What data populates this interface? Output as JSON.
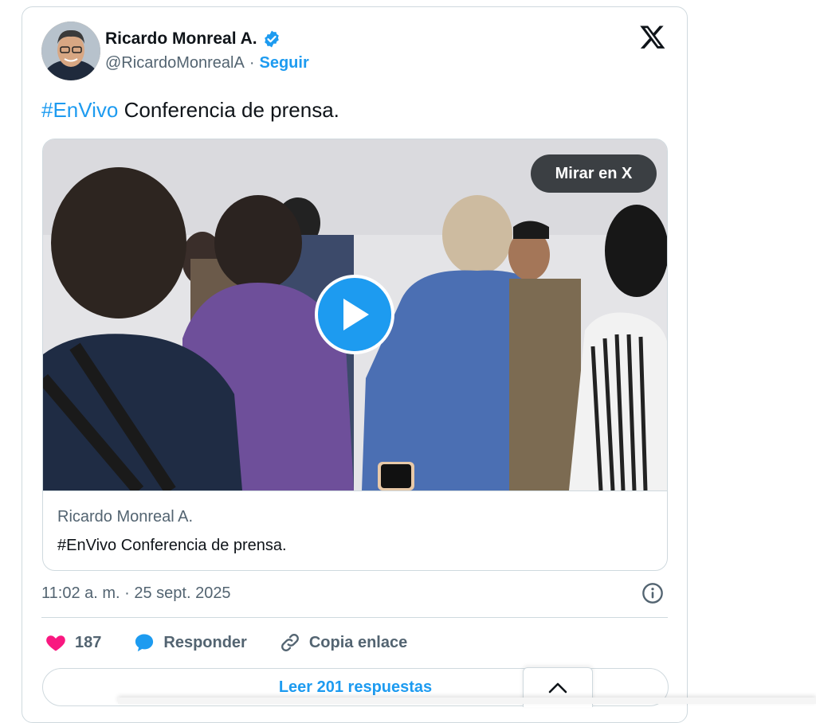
{
  "author": {
    "name": "Ricardo Monreal A.",
    "handle": "@RicardoMonrealA",
    "separator": "·",
    "follow_label": "Seguir",
    "avatar_icon": "avatar-photo",
    "verified_icon": "verified-badge-icon"
  },
  "tweet": {
    "hashtag": "#EnVivo",
    "text": " Conferencia de prensa."
  },
  "media": {
    "watch_label": "Mirar en X",
    "play_icon": "play-icon",
    "caption_author": "Ricardo Monreal A.",
    "caption_text": "#EnVivo Conferencia de prensa."
  },
  "meta": {
    "timestamp": "11:02 a. m. · 25 sept. 2025",
    "info_icon": "info-icon"
  },
  "actions": {
    "like_count": "187",
    "reply_label": "Responder",
    "copy_label": "Copia enlace"
  },
  "replies_button": "Leer 201 respuestas",
  "colors": {
    "accent": "#1d9bf0",
    "heart": "#f91880",
    "text": "#0f1419",
    "muted": "#536471",
    "border": "#cfd9de"
  }
}
